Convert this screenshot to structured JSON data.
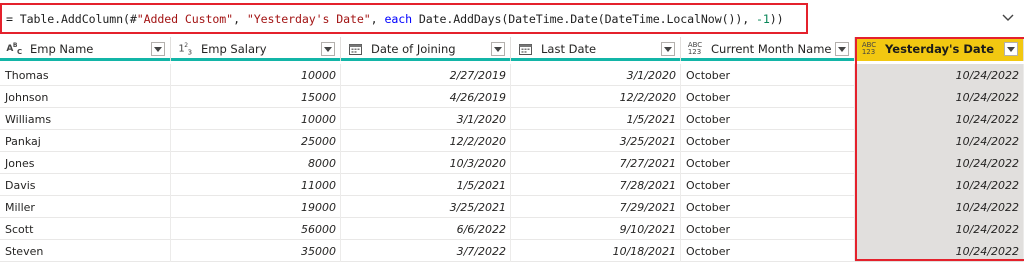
{
  "formula": {
    "eq": "=",
    "fn": " Table.AddColumn(#",
    "arg1": "\"Added Custom\"",
    "comma1": ", ",
    "arg2": "\"Yesterday's Date\"",
    "comma2": ", ",
    "kw": "each",
    "body": " Date.AddDays(DateTime.Date(DateTime.LocalNow()), ",
    "num": "-1",
    "close": "))",
    "expand_icon": "chevron-down-icon"
  },
  "columns": [
    {
      "name": "Emp Name",
      "type_icon": "ABC",
      "align": "left"
    },
    {
      "name": "Emp Salary",
      "type_icon": "123",
      "align": "right"
    },
    {
      "name": "Date of Joining",
      "type_icon": "calendar",
      "align": "right"
    },
    {
      "name": "Last Date",
      "type_icon": "calendar",
      "align": "right"
    },
    {
      "name": "Current Month Name",
      "type_icon": "ABC123",
      "align": "left"
    },
    {
      "name": "Yesterday's Date",
      "type_icon": "ABC123",
      "align": "right"
    }
  ],
  "rows": [
    [
      "Thomas",
      "10000",
      "2/27/2019",
      "3/1/2020",
      "October",
      "10/24/2022"
    ],
    [
      "Johnson",
      "15000",
      "4/26/2019",
      "12/2/2020",
      "October",
      "10/24/2022"
    ],
    [
      "Williams",
      "10000",
      "3/1/2020",
      "1/5/2021",
      "October",
      "10/24/2022"
    ],
    [
      "Pankaj",
      "25000",
      "12/2/2020",
      "3/25/2021",
      "October",
      "10/24/2022"
    ],
    [
      "Jones",
      "8000",
      "10/3/2020",
      "7/27/2021",
      "October",
      "10/24/2022"
    ],
    [
      "Davis",
      "11000",
      "1/5/2021",
      "7/28/2021",
      "October",
      "10/24/2022"
    ],
    [
      "Miller",
      "19000",
      "3/25/2021",
      "7/29/2021",
      "October",
      "10/24/2022"
    ],
    [
      "Scott",
      "56000",
      "6/6/2022",
      "9/10/2021",
      "October",
      "10/24/2022"
    ],
    [
      "Steven",
      "35000",
      "3/7/2022",
      "10/18/2021",
      "October",
      "10/24/2022"
    ]
  ],
  "colors": {
    "highlight_header": "#f2c811",
    "red_outline": "#e4212c",
    "teal_bar": "#13b5a7",
    "shaded_cell": "#e1dfdd"
  }
}
